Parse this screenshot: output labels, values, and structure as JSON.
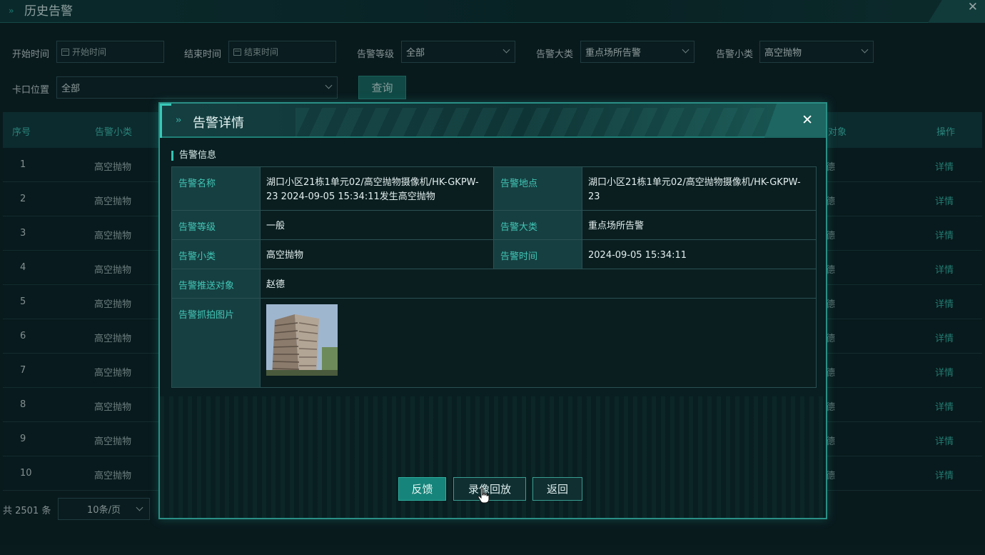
{
  "window": {
    "title": "历史告警",
    "close": "✕"
  },
  "filters": {
    "start_time_label": "开始时间",
    "start_time_placeholder": "开始时间",
    "end_time_label": "结束时间",
    "end_time_placeholder": "结束时间",
    "level_label": "告警等级",
    "level_value": "全部",
    "category_label": "告警大类",
    "category_value": "重点场所告警",
    "subcategory_label": "告警小类",
    "subcategory_value": "高空抛物",
    "location_label": "卡口位置",
    "location_value": "全部",
    "query_button": "查询"
  },
  "table": {
    "headers": {
      "index": "序号",
      "subcategory": "告警小类",
      "push_target": "对象",
      "operation": "操作"
    },
    "rows": [
      {
        "index": "1",
        "subcategory": "高空抛物",
        "edge": "德",
        "op": "详情"
      },
      {
        "index": "2",
        "subcategory": "高空抛物",
        "edge": "德",
        "op": "详情"
      },
      {
        "index": "3",
        "subcategory": "高空抛物",
        "edge": "德",
        "op": "详情"
      },
      {
        "index": "4",
        "subcategory": "高空抛物",
        "edge": "德",
        "op": "详情"
      },
      {
        "index": "5",
        "subcategory": "高空抛物",
        "edge": "德",
        "op": "详情"
      },
      {
        "index": "6",
        "subcategory": "高空抛物",
        "edge": "德",
        "op": "详情"
      },
      {
        "index": "7",
        "subcategory": "高空抛物",
        "edge": "德",
        "op": "详情"
      },
      {
        "index": "8",
        "subcategory": "高空抛物",
        "edge": "德",
        "op": "详情"
      },
      {
        "index": "9",
        "subcategory": "高空抛物",
        "edge": "德",
        "op": "详情"
      },
      {
        "index": "10",
        "subcategory": "高空抛物",
        "edge": "德",
        "op": "详情"
      }
    ]
  },
  "pagination": {
    "total": "共 2501 条",
    "page_size": "10条/页"
  },
  "modal": {
    "title": "告警详情",
    "close": "✕",
    "section_title": "告警信息",
    "fields": {
      "name_label": "告警名称",
      "name_value": "湖口小区21栋1单元02/高空抛物摄像机/HK-GKPW-23 2024-09-05 15:34:11发生高空抛物",
      "place_label": "告警地点",
      "place_value": "湖口小区21栋1单元02/高空抛物摄像机/HK-GKPW-23",
      "level_label": "告警等级",
      "level_value": "一般",
      "category_label": "告警大类",
      "category_value": "重点场所告警",
      "subcategory_label": "告警小类",
      "subcategory_value": "高空抛物",
      "time_label": "告警时间",
      "time_value": "2024-09-05 15:34:11",
      "push_label": "告警推送对象",
      "push_value": "赵德",
      "photo_label": "告警抓拍图片"
    },
    "buttons": {
      "feedback": "反馈",
      "playback": "录像回放",
      "back": "返回"
    }
  },
  "colors": {
    "accent": "#35c2b2",
    "background": "#0d2326",
    "primary_button": "#16847a"
  }
}
